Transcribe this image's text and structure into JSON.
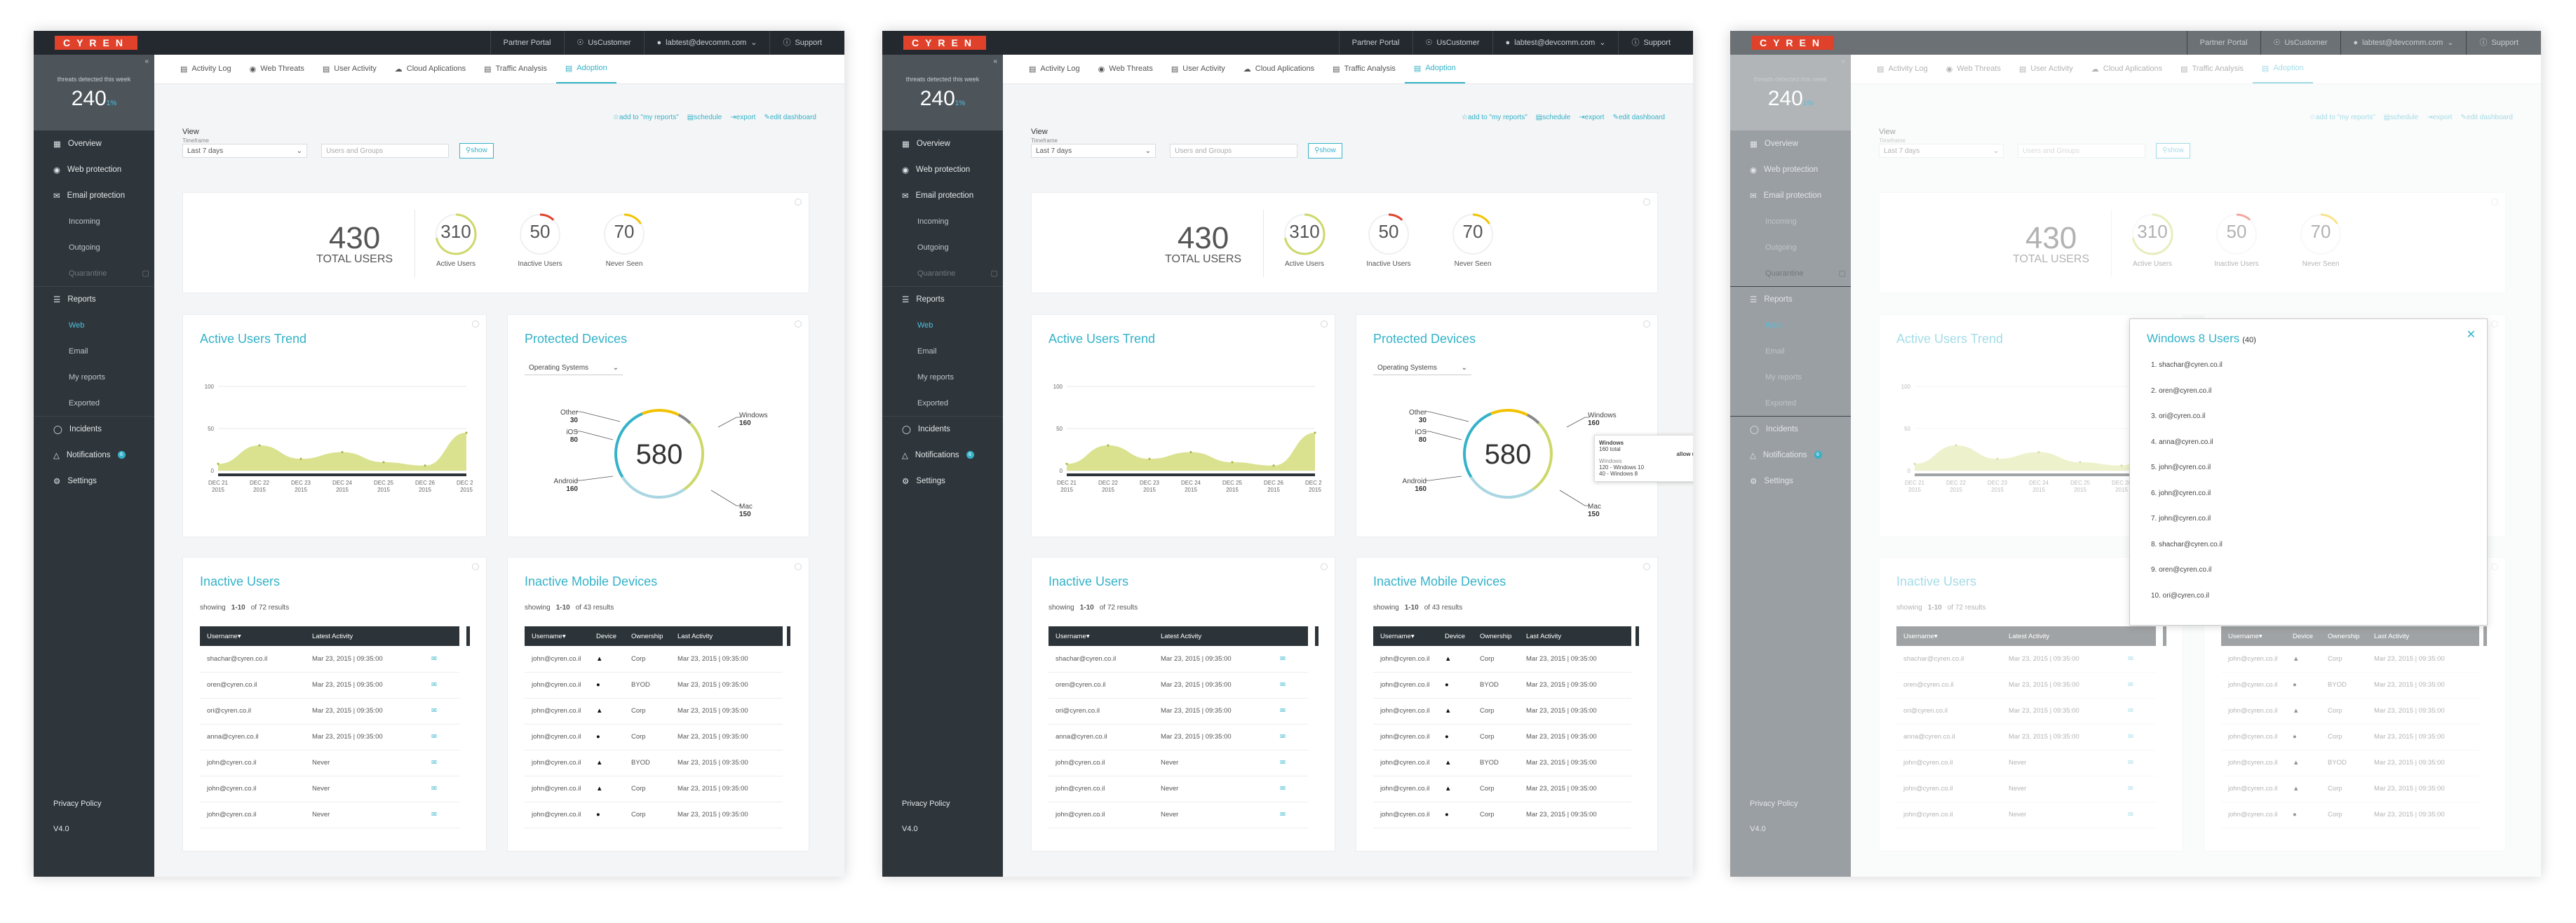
{
  "app": {
    "logo": "CYREN"
  },
  "topbar": {
    "partner_portal": "Partner Portal",
    "customer": "UsCustomer",
    "user": "labtest@devcomm.com",
    "support": "Support"
  },
  "sidebar": {
    "threats_label": "threats detected this week",
    "threats_count": "240",
    "threats_trend": "1%",
    "items": [
      "Overview",
      "Web protection",
      "Email protection",
      "Incoming",
      "Outgoing",
      "Quarantine",
      "Reports",
      "Web",
      "Email",
      "My reports",
      "Exported",
      "Incidents",
      "Notifications",
      "Settings"
    ],
    "notifications_badge": "6",
    "footer": {
      "privacy": "Privacy Policy",
      "version": "V4.0"
    }
  },
  "tabs": [
    "Activity Log",
    "Web Threats",
    "User Activity",
    "Cloud Aplications",
    "Traffic Analysis",
    "Adoption"
  ],
  "actions": {
    "add": "add to \"my reports\"",
    "schedule": "schedule",
    "export": "export",
    "edit": "edit dashboard"
  },
  "filters": {
    "view": "View",
    "timeframe": "Timeframe",
    "period": "Last 7 days",
    "users_placeholder": "Users and Groups",
    "show": "show"
  },
  "kpi": {
    "total": "430",
    "total_label": "TOTAL USERS",
    "rings": [
      {
        "value": "310",
        "label": "Active Users",
        "fraction": 0.72,
        "color": "#cdd86a"
      },
      {
        "value": "50",
        "label": "Inactive Users",
        "fraction": 0.12,
        "color": "#e0412b"
      },
      {
        "value": "70",
        "label": "Never Seen",
        "fraction": 0.16,
        "color": "#f2c200"
      }
    ]
  },
  "trend": {
    "title": "Active Users Trend",
    "yticks": [
      "100",
      "50",
      "0"
    ],
    "xticks": [
      [
        "DEC 21",
        "2015"
      ],
      [
        "DEC 22",
        "2015"
      ],
      [
        "DEC 23",
        "2015"
      ],
      [
        "DEC 24",
        "2015"
      ],
      [
        "DEC 25",
        "2015"
      ],
      [
        "DEC 26",
        "2015"
      ],
      [
        "DEC 27",
        "2015"
      ]
    ]
  },
  "chart_data": {
    "type": "area",
    "x": [
      "DEC 21 2015",
      "DEC 22 2015",
      "DEC 23 2015",
      "DEC 24 2015",
      "DEC 25 2015",
      "DEC 26 2015",
      "DEC 27 2015"
    ],
    "values": [
      8,
      30,
      14,
      22,
      10,
      6,
      45
    ],
    "ylim": [
      0,
      100
    ],
    "color": "#cdd86a"
  },
  "devices": {
    "title": "Protected Devices",
    "dropdown": "Operating Systems",
    "total": "580",
    "slices": [
      {
        "name": "Windows",
        "value": "160",
        "n": 160,
        "color": "#34b2c9"
      },
      {
        "name": "Mac",
        "value": "150",
        "n": 150,
        "color": "#a9d6e2"
      },
      {
        "name": "Android",
        "value": "160",
        "n": 160,
        "color": "#cdd86a"
      },
      {
        "name": "iOS",
        "value": "80",
        "n": 80,
        "color": "#f2c200"
      },
      {
        "name": "Other",
        "value": "30",
        "n": 30,
        "color": "#888888"
      }
    ],
    "tooltip": {
      "title": "Windows",
      "sub": "160 total",
      "label": "Windows",
      "rows": [
        "120 - Windows 10",
        "40 - Windows 8"
      ],
      "legend": "allow users"
    }
  },
  "inactive_users": {
    "title": "Inactive Users",
    "showing": "showing",
    "range": "1-10",
    "of": "of 72 results",
    "headers": [
      "Username",
      "Latest Activity"
    ],
    "rows": [
      [
        "shachar@cyren.co.il",
        "Mar 23, 2015  |  09:35:00"
      ],
      [
        "oren@cyren.co.il",
        "Mar 23, 2015  |  09:35:00"
      ],
      [
        "ori@cyren.co.il",
        "Mar 23, 2015  |  09:35:00"
      ],
      [
        "anna@cyren.co.il",
        "Mar 23, 2015  |  09:35:00"
      ],
      [
        "john@cyren.co.il",
        "Never"
      ],
      [
        "john@cyren.co.il",
        "Never"
      ],
      [
        "john@cyren.co.il",
        "Never"
      ]
    ]
  },
  "inactive_mobile": {
    "title": "Inactive Mobile Devices",
    "showing": "showing",
    "range": "1-10",
    "of": "of 43 results",
    "headers": [
      "Username",
      "Device",
      "Ownership",
      "Last Activity"
    ],
    "rows": [
      [
        "john@cyren.co.il",
        "android",
        "Corp",
        "Mar 23, 2015  |  09:35:00"
      ],
      [
        "john@cyren.co.il",
        "apple",
        "BYOD",
        "Mar 23, 2015  |  09:35:00"
      ],
      [
        "john@cyren.co.il",
        "android",
        "Corp",
        "Mar 23, 2015  |  09:35:00"
      ],
      [
        "john@cyren.co.il",
        "apple",
        "Corp",
        "Mar 23, 2015  |  09:35:00"
      ],
      [
        "john@cyren.co.il",
        "android",
        "BYOD",
        "Mar 23, 2015  |  09:35:00"
      ],
      [
        "john@cyren.co.il",
        "android",
        "Corp",
        "Mar 23, 2015  |  09:35:00"
      ],
      [
        "john@cyren.co.il",
        "apple",
        "Corp",
        "Mar 23, 2015  |  09:35:00"
      ]
    ]
  },
  "modal": {
    "title": "Windows 8 Users",
    "count": "(40)",
    "items": [
      "1. shachar@cyren.co.il",
      "2. oren@cyren.co.il",
      "3. ori@cyren.co.il",
      "4. anna@cyren.co.il",
      "5. john@cyren.co.il",
      "6. john@cyren.co.il",
      "7. john@cyren.co.il",
      "8. shachar@cyren.co.il",
      "9. oren@cyren.co.il",
      "10. ori@cyren.co.il"
    ]
  }
}
